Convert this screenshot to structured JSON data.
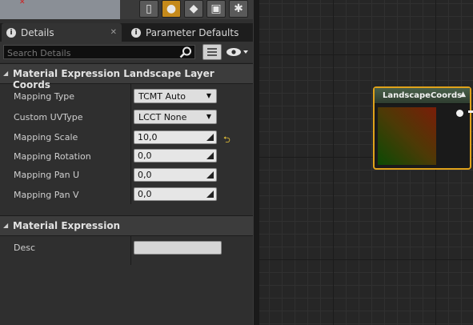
{
  "preview_toolbar": {
    "buttons": [
      {
        "name": "cylinder-preview-button",
        "glyph": "▯"
      },
      {
        "name": "sphere-preview-button",
        "glyph": "●"
      },
      {
        "name": "plane-preview-button",
        "glyph": "◆"
      },
      {
        "name": "cube-preview-button",
        "glyph": "▣"
      },
      {
        "name": "custom-mesh-preview-button",
        "glyph": "✱"
      }
    ],
    "active_index": 1
  },
  "tabs": [
    {
      "label": "Details",
      "active": true,
      "close": "✕"
    },
    {
      "label": "Parameter Defaults",
      "active": false
    }
  ],
  "search": {
    "placeholder": "Search Details",
    "value": ""
  },
  "categories": {
    "layer_coords": "Material Expression Landscape Layer Coords",
    "expression": "Material Expression"
  },
  "properties": {
    "mapping_type": {
      "label": "Mapping Type",
      "value": "TCMT Auto"
    },
    "custom_uv_type": {
      "label": "Custom UVType",
      "value": "LCCT None"
    },
    "mapping_scale": {
      "label": "Mapping Scale",
      "value": "10,0"
    },
    "mapping_rotation": {
      "label": "Mapping Rotation",
      "value": "0,0"
    },
    "mapping_pan_u": {
      "label": "Mapping Pan U",
      "value": "0,0"
    },
    "mapping_pan_v": {
      "label": "Mapping Pan V",
      "value": "0,0"
    },
    "desc": {
      "label": "Desc",
      "value": ""
    }
  },
  "node": {
    "title": "LandscapeCoords",
    "accent": "#e0a21a"
  },
  "colors": {
    "panel": "#2f2f2f",
    "graph": "#262626",
    "header": "#3c3c3c"
  }
}
